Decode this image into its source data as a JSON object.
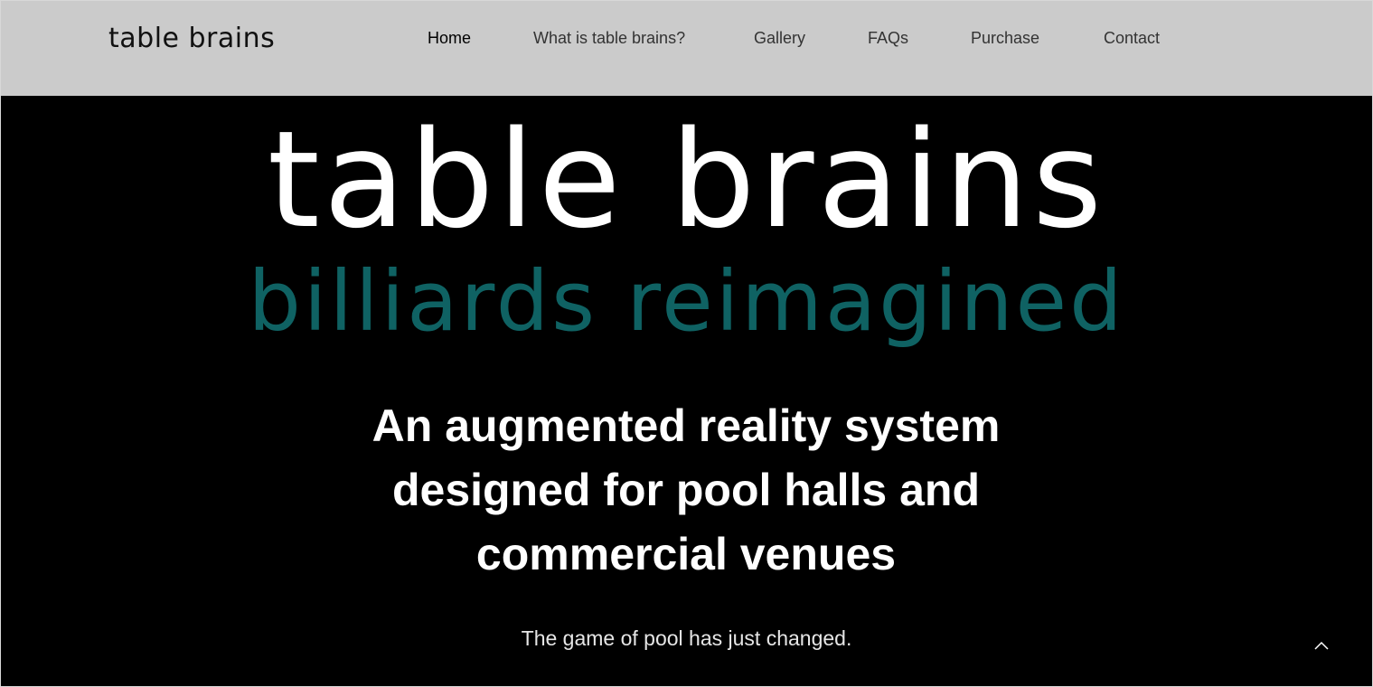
{
  "header": {
    "brand": "table brains",
    "nav": [
      {
        "label": "Home",
        "active": true
      },
      {
        "label": "What is table brains?",
        "active": false
      },
      {
        "label": "Gallery",
        "active": false
      },
      {
        "label": "FAQs",
        "active": false
      },
      {
        "label": "Purchase",
        "active": false
      },
      {
        "label": "Contact",
        "active": false
      }
    ]
  },
  "hero": {
    "logo_title": "table brains",
    "logo_subtitle": "billiards reimagined",
    "headline_line1": "An augmented reality system",
    "headline_line2": "designed for pool halls and",
    "headline_line3": "commercial venues",
    "tagline": "The game of pool has just changed."
  },
  "icons": {
    "scroll_top": "chevron-up-icon"
  },
  "colors": {
    "header_bg": "#cbcbcb",
    "hero_bg": "#000000",
    "accent_teal": "#0f6263",
    "text_light": "#ffffff"
  }
}
